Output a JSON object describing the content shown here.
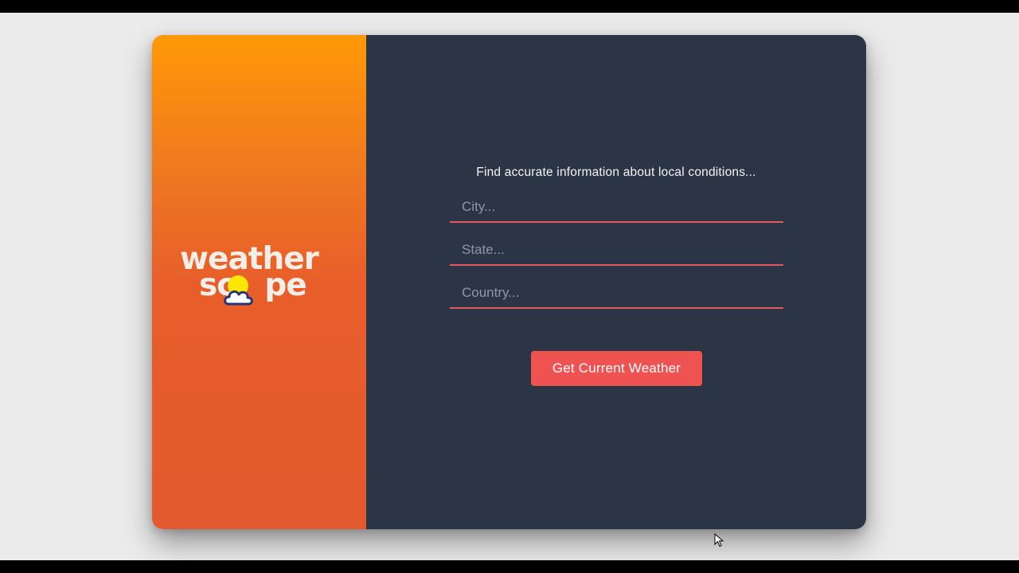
{
  "brand": {
    "logo_line1": "weather",
    "logo_line2_left": "sc",
    "logo_line2_right": "pe",
    "sun_color": "#ffe600",
    "cloud_outline_color": "#23347a",
    "gradient_top": "#ff9905",
    "gradient_bottom": "#e25a2d"
  },
  "form": {
    "tagline": "Find accurate information about local conditions...",
    "city_placeholder": "City...",
    "state_placeholder": "State...",
    "country_placeholder": "Country...",
    "submit_label": "Get Current Weather",
    "accent_color": "#ee5352",
    "panel_color": "#2b3546"
  },
  "icons": {
    "logo_icon": "sun-cloud-icon",
    "cursor_icon": "mouse-pointer-icon"
  }
}
